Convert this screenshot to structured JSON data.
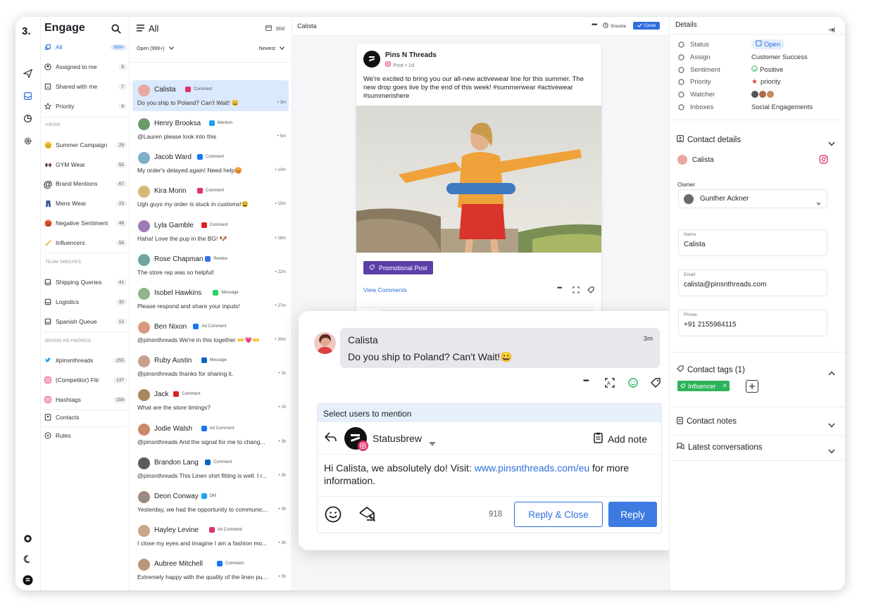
{
  "colors": {
    "accent": "#2f6fdc",
    "instagram": "#e1306c",
    "twitter": "#1da1f2",
    "facebook": "#1877f2",
    "linkedin": "#0a66c2",
    "promo": "#5b3fa8",
    "positive": "#2fb35a",
    "tag_green": "#2fb35a"
  },
  "rail": {
    "logo": "3.",
    "icons": [
      "send-icon",
      "inbox-icon",
      "analytics-icon",
      "settings-icon",
      "help-icon",
      "moon-icon",
      "brand-icon"
    ]
  },
  "sidebar": {
    "title": "Engage",
    "items": [
      {
        "label": "All",
        "count": "999+",
        "icon": "all-icon"
      },
      {
        "label": "Assigned to me",
        "count": "5",
        "icon": "user-icon"
      },
      {
        "label": "Shared with me",
        "count": "7",
        "icon": "share-icon"
      },
      {
        "label": "Priority",
        "count": "9",
        "icon": "star-icon"
      }
    ],
    "views_label": "VIEWS",
    "views": [
      {
        "label": "Summer Campaign",
        "count": "29",
        "icon": "sun-emoji-icon"
      },
      {
        "label": "GYM Wear",
        "count": "55",
        "icon": "gym-emoji-icon"
      },
      {
        "label": "Brand Mentions",
        "count": "67",
        "icon": "at-icon"
      },
      {
        "label": "Mens Wear",
        "count": "23",
        "icon": "jeans-emoji-icon"
      },
      {
        "label": "Negative Sentiment",
        "count": "49",
        "icon": "angry-emoji-icon"
      },
      {
        "label": "Influencers",
        "count": "56",
        "icon": "sparkle-emoji-icon"
      }
    ],
    "team_label": "TEAM INBOXES",
    "team": [
      {
        "label": "Shipping Queries",
        "count": "41",
        "icon": "inbox-icon"
      },
      {
        "label": "Logistics",
        "count": "32",
        "icon": "inbox-icon"
      },
      {
        "label": "Spanish Queue",
        "count": "12",
        "icon": "inbox-icon"
      }
    ],
    "brand_label": "BRAND KEYWORDS",
    "brand": [
      {
        "label": "#pinsnthreads",
        "count": "255",
        "icon": "twitter-icon"
      },
      {
        "label": "(Competitor) Fitr",
        "count": "137",
        "icon": "instagram-icon"
      },
      {
        "label": "Hashtags",
        "count": "159",
        "icon": "instagram-icon"
      }
    ],
    "bottom": [
      {
        "label": "Contacts",
        "icon": "contacts-icon"
      },
      {
        "label": "Rules",
        "icon": "rules-icon"
      }
    ]
  },
  "list": {
    "title": "All",
    "days": "30d",
    "filter": "Open (999+)",
    "sort": "Newest",
    "items": [
      {
        "name": "Calista",
        "src": "Comment",
        "network": "instagram",
        "msg": "Do you ship to Poland? Can't Wait! 😀",
        "time": "3m",
        "av": "#e8a7a0"
      },
      {
        "name": "Henry Brooksa",
        "src": "Mention",
        "network": "twitter",
        "msg": "@Lauren please look into this",
        "time": "5m",
        "av": "#6b9a6a"
      },
      {
        "name": "Jacob Ward",
        "src": "Comment",
        "network": "facebook",
        "msg": "My order's delayed again! Need help😡",
        "time": "10m",
        "av": "#7fb0c8"
      },
      {
        "name": "Kira Morin",
        "src": "Comment",
        "network": "instagram",
        "msg": "Ugh guys my order is stuck in customs!😫",
        "time": "15m",
        "av": "#d4b87a"
      },
      {
        "name": "Lyla Gamble",
        "src": "Comment",
        "network": "youtube",
        "msg": "Haha! Love the pup in the BG! 🐶",
        "time": "18m",
        "av": "#9b7bb5"
      },
      {
        "name": "Rose Chapman",
        "src": "Review",
        "network": "gmb",
        "msg": "The store rep was so helpful!",
        "time": "22m",
        "av": "#6fa6a0"
      },
      {
        "name": "Isobel Hawkins",
        "src": "Message",
        "network": "whatsapp",
        "msg": "Please respond and share your inputs!",
        "time": "27m",
        "av": "#8fb58a"
      },
      {
        "name": "Ben Nixon",
        "src": "Ad Comment",
        "network": "facebook",
        "msg": "@pinsnthreads We're in this together 👐💗👐",
        "time": "30m",
        "av": "#d49a7a"
      },
      {
        "name": "Ruby Austin",
        "src": "Message",
        "network": "linkedin",
        "msg": "@pinsnthreads thanks for sharing it.",
        "time": "1h",
        "av": "#c8a090"
      },
      {
        "name": "Jack",
        "src": "Comment",
        "network": "youtube",
        "msg": "What are the store timings?",
        "time": "1h",
        "av": "#a88860"
      },
      {
        "name": "Jodie Walsh",
        "src": "Ad Comment",
        "network": "facebook",
        "msg": "@pinsnthreads And the signal for me to chang...",
        "time": "3h",
        "av": "#c98a6a"
      },
      {
        "name": "Brandon Lang",
        "src": "Comment",
        "network": "linkedin",
        "msg": "@pinsnthreads This Linen shirt fitting is well. I r...",
        "time": "3h",
        "av": "#5a5a5a"
      },
      {
        "name": "Deon Conway",
        "src": "DM",
        "network": "twitter",
        "msg": "Yesterday, we had the opportunity to communic...",
        "time": "3h",
        "av": "#9a8a80"
      },
      {
        "name": "Hayley Levine",
        "src": "Ad Comment",
        "network": "instagram",
        "msg": "I close my eyes and imagine I am a fashion mo...",
        "time": "3h",
        "av": "#c8a888"
      },
      {
        "name": "Aubree Mitchell",
        "src": "Comment",
        "network": "facebook",
        "msg": "Extremely happy with the quality of the linen pu...",
        "time": "3h",
        "av": "#b89878"
      }
    ]
  },
  "center": {
    "title": "Calista",
    "snooze": "Snooze",
    "close": "Close",
    "post": {
      "author": "Pins N Threads",
      "meta": "Post • 1d",
      "text": "We're excited to bring you our all-new activewear line for this summer. The new drop goes live by the end of this week! #summerwear #activewear #summerishere",
      "tag": "Promotional Post",
      "view_comments": "View Comments"
    }
  },
  "reply": {
    "name": "Calista",
    "time": "3m",
    "msg": "Do you ship to Poland? Can't Wait!😀",
    "mention_bar": "Select users to mention",
    "account": "Statusbrew",
    "add_note": "Add note",
    "text_before": "Hi Calista, we absolutely do! Visit: ",
    "link": "www.pinsnthreads.com/eu",
    "text_after": " for more information.",
    "char_count": "918",
    "reply_close": "Reply & Close",
    "reply": "Reply"
  },
  "details": {
    "title": "Details",
    "rows": [
      {
        "label": "Status",
        "value": "Open",
        "icon": "status-icon"
      },
      {
        "label": "Assign",
        "value": "Customer Success",
        "icon": "assign-icon"
      },
      {
        "label": "Sentiment",
        "value": "Positive",
        "icon": "sentiment-icon"
      },
      {
        "label": "Priority",
        "value": "priority",
        "icon": "priority-star-icon"
      },
      {
        "label": "Watcher",
        "value": "",
        "icon": "eye-icon"
      },
      {
        "label": "Inboxes",
        "value": "Social Engagements",
        "icon": "inbox-icon"
      }
    ],
    "contact_details": "Contact details",
    "contact_name": "Calista",
    "owner_label": "Owner",
    "owner": "Gunther Ackner",
    "name_label": "Name",
    "name_value": "Calista",
    "email_label": "Email",
    "email_value": "calista@pinsnthreads.com",
    "phone_label": "Phone",
    "phone_value": "+91 2155984115",
    "tags_title": "Contact tags (1)",
    "tag": "Influencer",
    "notes_title": "Contact notes",
    "latest_title": "Latest conversations"
  }
}
